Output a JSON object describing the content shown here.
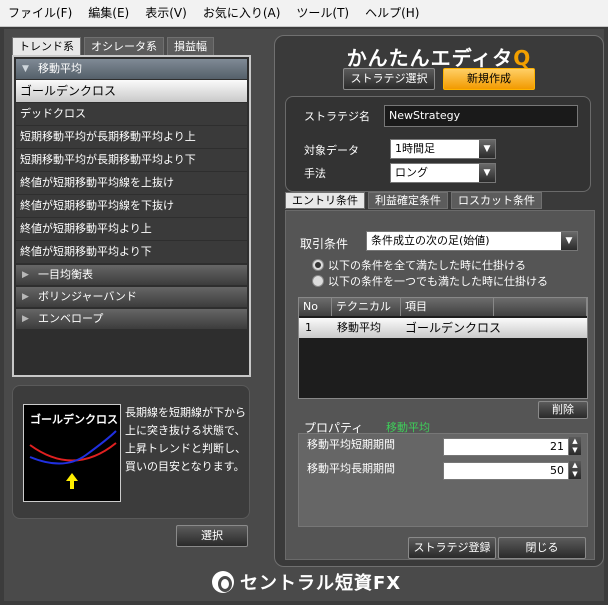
{
  "menu": [
    "ファイル(F)",
    "編集(E)",
    "表示(V)",
    "お気に入り(A)",
    "ツール(T)",
    "ヘルプ(H)"
  ],
  "left_tabs": [
    "トレンド系",
    "オシレータ系",
    "損益幅"
  ],
  "list": {
    "group_open": "移動平均",
    "items": [
      "ゴールデンクロス",
      "デッドクロス",
      "短期移動平均が長期移動平均より上",
      "短期移動平均が長期移動平均より下",
      "終値が短期移動平均線を上抜け",
      "終値が短期移動平均線を下抜け",
      "終値が短期移動平均より上",
      "終値が短期移動平均より下"
    ],
    "groups_closed": [
      "一目均衡表",
      "ボリンジャーバンド",
      "エンベロープ"
    ]
  },
  "description": {
    "image_title": "ゴールデンクロス",
    "text": "長期線を短期線が下から上に突き抜ける状態で、上昇トレンドと判断し、買いの目安となります。",
    "colors": {
      "long_line": "#e02020",
      "short_line": "#2030e0",
      "arrow": "#ffee00"
    }
  },
  "select_button": "選択",
  "editor": {
    "title_main": "かんたんエディタ",
    "title_q": "Q",
    "strategy_select": "ストラテジ選択",
    "new_create": "新規作成",
    "name_label": "ストラテジ名",
    "name_value": "NewStrategy",
    "data_label": "対象データ",
    "data_value": "1時間足",
    "method_label": "手法",
    "method_value": "ロング",
    "tabs": [
      "エントリ条件",
      "利益確定条件",
      "ロスカット条件"
    ],
    "trade_cond_label": "取引条件",
    "trade_cond_value": "条件成立の次の足(始値)",
    "radio_all": "以下の条件を全て満たした時に仕掛ける",
    "radio_any": "以下の条件を一つでも満たした時に仕掛ける",
    "table_headers": [
      "No",
      "テクニカル",
      "項目"
    ],
    "row": {
      "no": "1",
      "technical": "移動平均",
      "item": "ゴールデンクロス"
    },
    "delete": "削除",
    "property_label": "プロパティ",
    "property_value": "移動平均",
    "ma_short_label": "移動平均短期期間",
    "ma_short_value": "21",
    "ma_long_label": "移動平均長期期間",
    "ma_long_value": "50",
    "register": "ストラテジ登録",
    "close": "閉じる"
  },
  "footer": "セントラル短資FX",
  "colors": {
    "accent": "#f29a00",
    "green": "#3ecf5a"
  }
}
